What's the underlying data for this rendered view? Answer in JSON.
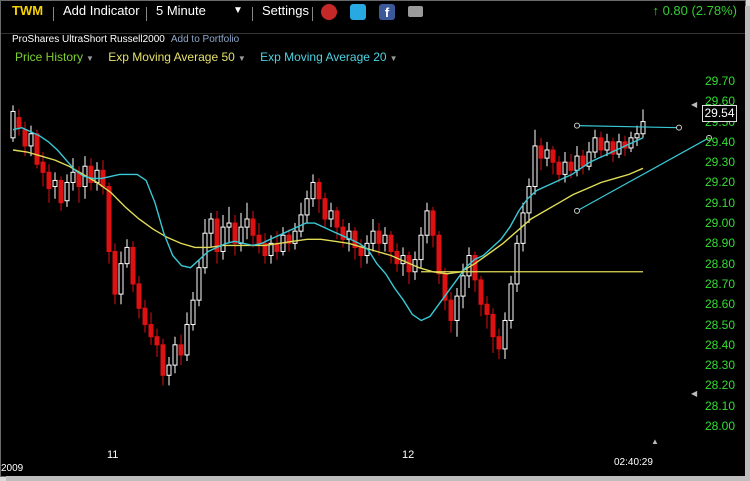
{
  "toolbar": {
    "symbol": "TWM",
    "add_indicator": "Add Indicator",
    "interval": "5 Minute",
    "settings": "Settings",
    "facebook_glyph": "f",
    "change": "0.80 (2.78%)",
    "change_color": "#33cc33",
    "icons": [
      "chevron-down-icon",
      "alarm-clock-icon",
      "twitter-icon",
      "facebook-icon",
      "camera-icon",
      "up-arrow-icon"
    ]
  },
  "subtitle": {
    "name": "ProShares UltraShort Russell2000",
    "add_link": "Add to Portfolio"
  },
  "legend": {
    "price": "Price History",
    "ema50": "Exp Moving Average 50",
    "ema20": "Exp Moving Average 20",
    "colors": {
      "price": "#7cd233",
      "ema50": "#e4e06a",
      "ema20": "#4fd1e0"
    }
  },
  "price_axis": {
    "ticks": [
      "29.70",
      "29.60",
      "29.50",
      "29.40",
      "29.30",
      "29.20",
      "29.10",
      "29.00",
      "28.90",
      "28.80",
      "28.70",
      "28.60",
      "28.50",
      "28.40",
      "28.30",
      "28.20",
      "28.10",
      "28.00"
    ],
    "current_price": "29.54"
  },
  "time_axis": {
    "labels": [
      "11",
      "12"
    ],
    "year_fragment": "2009",
    "time": "02:40:29"
  },
  "chart_data": {
    "type": "candlestick",
    "y_range": [
      28.0,
      29.7
    ],
    "colors": {
      "up": "#ffffff",
      "down": "#dd1111",
      "ema20": "#39c9d6",
      "ema50": "#e0dc58",
      "trendline": "#39c9d6",
      "support": "#e0dc58"
    },
    "candles": [
      [
        29.42,
        29.55,
        29.58,
        29.4
      ],
      [
        29.52,
        29.47,
        29.56,
        29.43
      ],
      [
        29.46,
        29.38,
        29.5,
        29.33
      ],
      [
        29.38,
        29.44,
        29.48,
        29.33
      ],
      [
        29.44,
        29.29,
        29.46,
        29.27
      ],
      [
        29.3,
        29.25,
        29.35,
        29.18
      ],
      [
        29.25,
        29.17,
        29.29,
        29.1
      ],
      [
        29.18,
        29.21,
        29.25,
        29.12
      ],
      [
        29.21,
        29.1,
        29.23,
        29.06
      ],
      [
        29.11,
        29.2,
        29.24,
        29.08
      ],
      [
        29.2,
        29.25,
        29.32,
        29.16
      ],
      [
        29.25,
        29.18,
        29.28,
        29.1
      ],
      [
        29.18,
        29.28,
        29.33,
        29.12
      ],
      [
        29.28,
        29.2,
        29.32,
        29.16
      ],
      [
        29.2,
        29.26,
        29.3,
        29.16
      ],
      [
        29.26,
        29.18,
        29.31,
        29.14
      ],
      [
        29.18,
        28.86,
        29.2,
        28.8
      ],
      [
        28.86,
        28.65,
        28.9,
        28.6
      ],
      [
        28.65,
        28.8,
        28.86,
        28.6
      ],
      [
        28.8,
        28.88,
        28.92,
        28.78
      ],
      [
        28.88,
        28.7,
        28.91,
        28.66
      ],
      [
        28.7,
        28.58,
        28.74,
        28.53
      ],
      [
        28.58,
        28.5,
        28.62,
        28.46
      ],
      [
        28.5,
        28.44,
        28.56,
        28.4
      ],
      [
        28.44,
        28.4,
        28.48,
        28.34
      ],
      [
        28.4,
        28.25,
        28.43,
        28.2
      ],
      [
        28.25,
        28.3,
        28.34,
        28.2
      ],
      [
        28.3,
        28.4,
        28.44,
        28.26
      ],
      [
        28.4,
        28.35,
        28.45,
        28.3
      ],
      [
        28.35,
        28.5,
        28.56,
        28.32
      ],
      [
        28.5,
        28.62,
        28.66,
        28.47
      ],
      [
        28.62,
        28.78,
        28.82,
        28.59
      ],
      [
        28.78,
        28.95,
        29.02,
        28.75
      ],
      [
        28.95,
        29.02,
        29.05,
        28.88
      ],
      [
        29.02,
        28.86,
        29.06,
        28.8
      ],
      [
        28.86,
        28.98,
        29.04,
        28.82
      ],
      [
        28.98,
        29.0,
        29.08,
        28.9
      ],
      [
        29.0,
        28.9,
        29.04,
        28.84
      ],
      [
        28.9,
        28.98,
        29.05,
        28.86
      ],
      [
        28.98,
        29.02,
        29.1,
        28.92
      ],
      [
        29.02,
        28.94,
        29.06,
        28.88
      ],
      [
        28.94,
        28.9,
        29.0,
        28.85
      ],
      [
        28.9,
        28.84,
        28.95,
        28.8
      ],
      [
        28.84,
        28.9,
        28.94,
        28.8
      ],
      [
        28.9,
        28.86,
        28.96,
        28.82
      ],
      [
        28.86,
        28.94,
        28.98,
        28.84
      ],
      [
        28.94,
        28.9,
        28.97,
        28.86
      ],
      [
        28.9,
        28.96,
        29.0,
        28.87
      ],
      [
        28.96,
        29.04,
        29.1,
        28.93
      ],
      [
        29.04,
        29.12,
        29.16,
        29.0
      ],
      [
        29.12,
        29.2,
        29.24,
        29.08
      ],
      [
        29.2,
        29.12,
        29.22,
        29.05
      ],
      [
        29.12,
        29.02,
        29.15,
        28.98
      ],
      [
        29.02,
        29.06,
        29.1,
        28.98
      ],
      [
        29.06,
        28.98,
        29.08,
        28.92
      ],
      [
        28.98,
        28.92,
        29.02,
        28.88
      ],
      [
        28.92,
        28.96,
        29.0,
        28.86
      ],
      [
        28.96,
        28.88,
        28.98,
        28.82
      ],
      [
        28.88,
        28.84,
        28.92,
        28.78
      ],
      [
        28.84,
        28.9,
        28.94,
        28.8
      ],
      [
        28.9,
        28.96,
        29.02,
        28.86
      ],
      [
        28.96,
        28.9,
        29.0,
        28.84
      ],
      [
        28.9,
        28.94,
        28.98,
        28.86
      ],
      [
        28.94,
        28.86,
        28.96,
        28.8
      ],
      [
        28.86,
        28.8,
        28.9,
        28.76
      ],
      [
        28.8,
        28.84,
        28.88,
        28.74
      ],
      [
        28.84,
        28.76,
        28.86,
        28.7
      ],
      [
        28.76,
        28.82,
        28.86,
        28.72
      ],
      [
        28.82,
        28.94,
        28.98,
        28.78
      ],
      [
        28.94,
        29.06,
        29.1,
        28.9
      ],
      [
        29.06,
        28.94,
        29.08,
        28.88
      ],
      [
        28.94,
        28.75,
        28.96,
        28.7
      ],
      [
        28.75,
        28.62,
        28.78,
        28.57
      ],
      [
        28.62,
        28.52,
        28.66,
        28.46
      ],
      [
        28.52,
        28.64,
        28.68,
        28.44
      ],
      [
        28.64,
        28.74,
        28.8,
        28.58
      ],
      [
        28.74,
        28.84,
        28.88,
        28.68
      ],
      [
        28.84,
        28.72,
        28.86,
        28.66
      ],
      [
        28.72,
        28.6,
        28.74,
        28.54
      ],
      [
        28.6,
        28.55,
        28.64,
        28.48
      ],
      [
        28.55,
        28.44,
        28.58,
        28.36
      ],
      [
        28.44,
        28.38,
        28.48,
        28.33
      ],
      [
        28.38,
        28.52,
        28.56,
        28.33
      ],
      [
        28.52,
        28.7,
        28.74,
        28.48
      ],
      [
        28.7,
        28.9,
        28.94,
        28.66
      ],
      [
        28.9,
        29.05,
        29.1,
        28.86
      ],
      [
        29.05,
        29.18,
        29.22,
        29.0
      ],
      [
        29.18,
        29.38,
        29.46,
        29.14
      ],
      [
        29.38,
        29.32,
        29.42,
        29.26
      ],
      [
        29.32,
        29.36,
        29.4,
        29.28
      ],
      [
        29.36,
        29.3,
        29.38,
        29.24
      ],
      [
        29.3,
        29.24,
        29.33,
        29.2
      ],
      [
        29.24,
        29.3,
        29.35,
        29.2
      ],
      [
        29.3,
        29.26,
        29.34,
        29.22
      ],
      [
        29.26,
        29.33,
        29.38,
        29.23
      ],
      [
        29.33,
        29.28,
        29.36,
        29.24
      ],
      [
        29.28,
        29.35,
        29.4,
        29.26
      ],
      [
        29.35,
        29.42,
        29.46,
        29.32
      ],
      [
        29.42,
        29.36,
        29.45,
        29.32
      ],
      [
        29.36,
        29.4,
        29.44,
        29.33
      ],
      [
        29.4,
        29.34,
        29.42,
        29.3
      ],
      [
        29.34,
        29.4,
        29.44,
        29.32
      ],
      [
        29.4,
        29.37,
        29.43,
        29.33
      ],
      [
        29.37,
        29.42,
        29.45,
        29.35
      ],
      [
        29.42,
        29.44,
        29.48,
        29.38
      ],
      [
        29.44,
        29.5,
        29.56,
        29.42
      ]
    ],
    "ema20": [
      29.46,
      29.47,
      29.45,
      29.43,
      29.4,
      29.36,
      29.31,
      29.26,
      29.23,
      29.22,
      29.22,
      29.23,
      29.24,
      29.24,
      29.24,
      29.21,
      29.1,
      28.95,
      28.84,
      28.79,
      28.78,
      28.82,
      28.86,
      28.88,
      28.9,
      28.91,
      28.9,
      28.89,
      28.9,
      28.92,
      28.94,
      28.96,
      28.98,
      29.0,
      29.0,
      28.98,
      28.96,
      28.94,
      28.92,
      28.9,
      28.87,
      28.8,
      28.75,
      28.68,
      28.62,
      28.55,
      28.52,
      28.54,
      28.6,
      28.66,
      28.72,
      28.78,
      28.82,
      28.84,
      28.88,
      28.92,
      28.98,
      29.06,
      29.12,
      29.16,
      29.18,
      29.2,
      29.22,
      29.24,
      29.27,
      29.3,
      29.32,
      29.34,
      29.36,
      29.38,
      29.4,
      29.42
    ],
    "ema50": [
      29.36,
      29.35,
      29.33,
      29.31,
      29.28,
      29.24,
      29.2,
      29.15,
      29.08,
      29.02,
      28.97,
      28.93,
      28.9,
      28.88,
      28.88,
      28.89,
      28.89,
      28.89,
      28.89,
      28.9,
      28.91,
      28.92,
      28.92,
      28.91,
      28.9,
      28.88,
      28.86,
      28.84,
      28.81,
      28.78,
      28.76,
      28.75,
      28.76,
      28.8,
      28.85,
      28.9,
      28.96,
      29.02,
      29.06,
      29.1,
      29.14,
      29.17,
      29.2,
      29.22,
      29.24,
      29.27
    ],
    "trendline_upper": {
      "from": [
        29.48,
        94
      ],
      "to": [
        29.47,
        111
      ]
    },
    "trendline_lower": {
      "from": [
        29.06,
        94
      ],
      "to": [
        29.42,
        116
      ]
    },
    "support_level": 28.76
  }
}
